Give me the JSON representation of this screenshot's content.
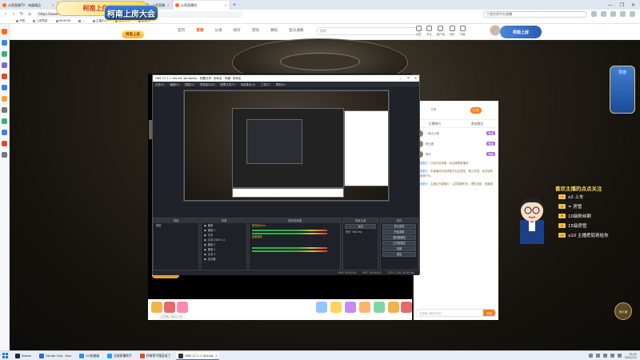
{
  "browser": {
    "tabs": [
      {
        "label": "斗鱼直播TV - 海量精品",
        "active": false,
        "color": "#ff6b1a"
      },
      {
        "label": "第一看 - 老师讲课",
        "active": false,
        "color": "#e33"
      },
      {
        "label": "第一看 - 老师讲课 - 斗鱼直播",
        "active": false,
        "color": "#e33"
      },
      {
        "label": "斗鱼直播间",
        "active": true,
        "color": "#ff6b1a"
      }
    ],
    "new_tab": "+",
    "url": "https://www.douyu.com/topic/KCH2022?rid=7709514",
    "search_placeholder": "二型空间平台直播",
    "bookmarks": [
      "书签",
      "上网导航",
      "HEHEHE",
      "...",
      "主播中心",
      "游戏中心",
      "直播间"
    ],
    "window_controls": [
      "—",
      "❐",
      "✕"
    ]
  },
  "site": {
    "logo_text": "柯南上房大会",
    "ribbon_text": "柯南上房大会",
    "badge_text": "柯南上房",
    "nav": [
      {
        "label": "首页",
        "active": false
      },
      {
        "label": "直播",
        "active": true
      },
      {
        "label": "分类",
        "active": false
      },
      {
        "label": "视听",
        "active": false
      },
      {
        "label": "游戏",
        "active": false
      },
      {
        "label": "赛程",
        "active": false
      },
      {
        "label": "鱼乐通典",
        "active": false
      }
    ],
    "search_placeholder": "搜索",
    "header_icons": [
      "历史",
      "关注",
      "客户端",
      "创作",
      "开播"
    ],
    "user_badge": "柯南上房"
  },
  "obs": {
    "title": "OBS 27.1.1 (64-bit, windows) - 配置文件: 未命名 - 场景: 未命名",
    "menu": [
      "文件(F)",
      "编辑(E)",
      "视图(V)",
      "停靠窗口(D)",
      "配置文件(P)",
      "场景集合(S)",
      "工具(T)",
      "帮助(H)"
    ],
    "docks": {
      "scenes_title": "场景",
      "scenes": [
        "场景"
      ],
      "sources_title": "来源",
      "sources": [
        "图像",
        "图像 2",
        "文本",
        "文本 (GDI+) 2",
        "图像 3",
        "图像 4",
        "文本 2",
        "显示器"
      ],
      "mixer_title": "音频混音器",
      "mixer_tracks": [
        "麦克风/Aux",
        "桌面音频"
      ],
      "transitions_title": "场景过渡",
      "transition_value": "淡出",
      "duration_label": "时长",
      "duration_value": "300 ms",
      "controls_title": "控件",
      "controls": [
        "停止推流",
        "开始录制",
        "虚拟摄像机",
        "工作室模式",
        "设置",
        "退出"
      ]
    },
    "status": [
      "LIVE: 00:00:00",
      "REC: 00:00:00",
      "CPU: 2.2%, 30.00 fps"
    ]
  },
  "room": {
    "top_actions": [
      "分享",
      "礼物"
    ],
    "panel_tabs": [
      "主播排行",
      "贵宾席位"
    ],
    "fans": [
      {
        "name": "一鼎大大佬",
        "badge": "等级"
      },
      {
        "name": "粉丝团",
        "badge": "等级"
      },
      {
        "name": "观众",
        "badge": "等级"
      }
    ],
    "chat": [
      {
        "n": "系统提示：",
        "t": "已经开启房管，欢迎观看直播间"
      },
      {
        "n": "系统提示：",
        "t": "本直播间内容请遵守社区规范，禁止低俗、攻击谩骂等违规行为。"
      },
      {
        "n": "系统提示：",
        "t": "主播正在直播中，注意观看时长，理性消费，适度娱乐。"
      }
    ],
    "input_placeholder": "这里输入聊天内容",
    "send_label": "发送",
    "gift_input_placeholder": "这里输入聊天内容"
  },
  "promo": {
    "title": "喜欢主播的点点关注",
    "rows": [
      {
        "tag": "x2",
        "text": "x2 上车"
      },
      {
        "tag": "房",
        "text": "= 房管"
      },
      {
        "tag": "粉",
        "text": "10级粉丝群"
      },
      {
        "tag": "房",
        "text": "15级房管"
      },
      {
        "tag": "x10",
        "text": "x10 主播把屁奇给你"
      }
    ]
  },
  "right_badge": "导游",
  "round_badge": "鱼乐通",
  "left_badge": "柯南",
  "taskbar": {
    "items": [
      {
        "label": "Steam",
        "color": "#1b2838",
        "active": false
      },
      {
        "label": "Studio One - Bus",
        "color": "#2a6bd1",
        "active": false
      },
      {
        "label": "UU加速器",
        "color": "#2d8cf0",
        "active": false
      },
      {
        "label": "全能直播助手",
        "color": "#1da1f2",
        "active": false
      },
      {
        "label": "柯南第不懂没成了",
        "color": "#e34a2a",
        "active": false
      },
      {
        "label": "OBS 27.1.1 (64-bit...)",
        "color": "#303030",
        "active": true
      }
    ],
    "time": "15:01",
    "date": "2022/1/1"
  }
}
